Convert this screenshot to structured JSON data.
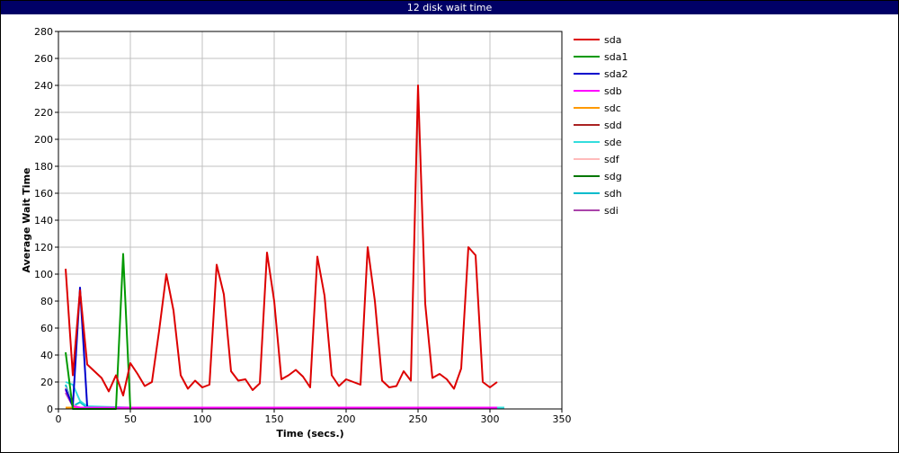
{
  "window": {
    "title": "12 disk wait time"
  },
  "chart_data": {
    "type": "line",
    "title": "12 disk wait time",
    "xlabel": "Time (secs.)",
    "ylabel": "Average Wait Time",
    "xlim": [
      0,
      350
    ],
    "ylim": [
      0,
      280
    ],
    "xticks": [
      0,
      50,
      100,
      150,
      200,
      250,
      300,
      350
    ],
    "yticks": [
      0,
      20,
      40,
      60,
      80,
      100,
      120,
      140,
      160,
      180,
      200,
      220,
      240,
      260,
      280
    ],
    "grid": true,
    "legend_position": "right",
    "series": [
      {
        "name": "sda",
        "color": "#dd0000",
        "x": [
          5,
          10,
          15,
          20,
          25,
          30,
          35,
          40,
          45,
          50,
          55,
          60,
          65,
          70,
          75,
          80,
          85,
          90,
          95,
          100,
          105,
          110,
          115,
          120,
          125,
          130,
          135,
          140,
          145,
          150,
          155,
          160,
          165,
          170,
          175,
          180,
          185,
          190,
          195,
          200,
          205,
          210,
          215,
          220,
          225,
          230,
          235,
          240,
          245,
          250,
          255,
          260,
          265,
          270,
          275,
          280,
          285,
          290,
          295,
          300,
          305
        ],
        "y": [
          104,
          25,
          88,
          33,
          28,
          23,
          13,
          25,
          10,
          34,
          26,
          17,
          20,
          58,
          100,
          73,
          25,
          15,
          21,
          16,
          18,
          107,
          85,
          28,
          21,
          22,
          14,
          19,
          116,
          80,
          22,
          25,
          29,
          24,
          16,
          113,
          84,
          25,
          17,
          22,
          20,
          18,
          120,
          80,
          21,
          16,
          17,
          28,
          21,
          240,
          78,
          23,
          26,
          22,
          15,
          30,
          120,
          114,
          20,
          16,
          20
        ]
      },
      {
        "name": "sda1",
        "color": "#009900",
        "x": [
          5,
          10,
          15,
          20,
          25,
          30,
          35,
          40,
          45,
          50
        ],
        "y": [
          42,
          0,
          0,
          0,
          0,
          0,
          0,
          0,
          115,
          0
        ]
      },
      {
        "name": "sda2",
        "color": "#0000cc",
        "x": [
          5,
          10,
          15,
          20
        ],
        "y": [
          15,
          2,
          90,
          2
        ]
      },
      {
        "name": "sdb",
        "color": "#ff00ff",
        "x": [
          5,
          10,
          15,
          20,
          30,
          40,
          50,
          60,
          70,
          80,
          90,
          100,
          110,
          120,
          130,
          140,
          150,
          160,
          170,
          180,
          190,
          200,
          210,
          220,
          230,
          240,
          250,
          260,
          270,
          280,
          290,
          300,
          305
        ],
        "y": [
          14,
          2,
          1,
          1,
          1,
          1,
          1,
          1,
          1,
          1,
          1,
          1,
          1,
          1,
          1,
          1,
          1,
          1,
          1,
          1,
          1,
          1,
          1,
          1,
          1,
          1,
          1,
          1,
          1,
          1,
          1,
          1,
          1
        ]
      },
      {
        "name": "sdc",
        "color": "#ff9900",
        "x": [
          5,
          10,
          15,
          20,
          50,
          100,
          150,
          200,
          250,
          300,
          305
        ],
        "y": [
          1,
          1,
          1,
          1,
          1,
          1,
          1,
          1,
          1,
          1,
          1
        ]
      },
      {
        "name": "sdd",
        "color": "#aa2222",
        "x": [
          5,
          10,
          15,
          20,
          50,
          100,
          150,
          200,
          250,
          300,
          305
        ],
        "y": [
          1,
          1,
          1,
          1,
          1,
          1,
          1,
          1,
          1,
          1,
          1
        ]
      },
      {
        "name": "sde",
        "color": "#33dddd",
        "x": [
          5,
          10,
          15,
          20,
          50,
          100,
          150,
          200,
          250,
          300,
          310
        ],
        "y": [
          20,
          18,
          6,
          2,
          1,
          1,
          1,
          1,
          1,
          1,
          1
        ]
      },
      {
        "name": "sdf",
        "color": "#ffbbbb",
        "x": [
          5,
          10,
          15,
          20,
          50,
          100,
          150,
          200,
          250,
          300,
          305
        ],
        "y": [
          16,
          3,
          1,
          1,
          1,
          1,
          1,
          1,
          1,
          1,
          1
        ]
      },
      {
        "name": "sdg",
        "color": "#007700",
        "x": [
          5,
          10,
          15,
          20,
          50,
          100,
          150,
          200,
          250,
          300,
          305
        ],
        "y": [
          1,
          1,
          1,
          1,
          1,
          1,
          1,
          1,
          1,
          1,
          1
        ]
      },
      {
        "name": "sdh",
        "color": "#00bbcc",
        "x": [
          5,
          10,
          15,
          20,
          50,
          100,
          150,
          200,
          250,
          300,
          310
        ],
        "y": [
          18,
          2,
          5,
          1,
          1,
          1,
          1,
          1,
          1,
          1,
          1
        ]
      },
      {
        "name": "sdi",
        "color": "#aa44aa",
        "x": [
          5,
          10,
          15,
          20,
          50,
          100,
          150,
          200,
          250,
          300,
          305
        ],
        "y": [
          12,
          2,
          1,
          1,
          1,
          1,
          1,
          1,
          1,
          1,
          1
        ]
      }
    ]
  }
}
